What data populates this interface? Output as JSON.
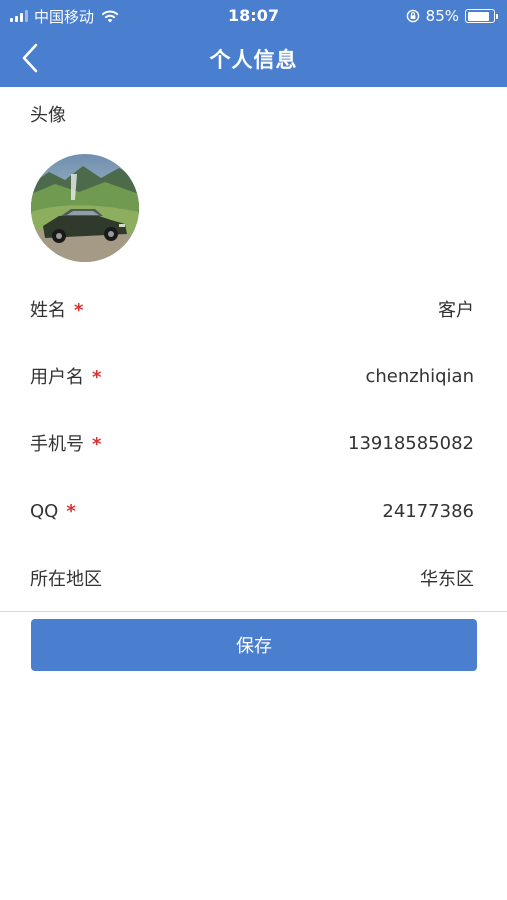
{
  "status_bar": {
    "carrier": "中国移动",
    "time": "18:07",
    "battery_percent": "85%",
    "battery_level": 0.85,
    "icons": [
      "signal-icon",
      "wifi-icon",
      "rotation-lock-icon",
      "battery-icon"
    ]
  },
  "nav": {
    "title": "个人信息",
    "back_icon": "chevron-left-icon"
  },
  "avatar": {
    "label": "头像"
  },
  "form": {
    "rows": [
      {
        "label": "姓名",
        "required": true,
        "value": "客户"
      },
      {
        "label": "用户名",
        "required": true,
        "value": "chenzhiqian"
      },
      {
        "label": "手机号",
        "required": true,
        "value": "13918585082"
      },
      {
        "label": "QQ",
        "required": true,
        "value": "24177386"
      },
      {
        "label": "所在地区",
        "required": false,
        "value": "华东区"
      }
    ],
    "required_mark": "*"
  },
  "actions": {
    "save_label": "保存"
  },
  "colors": {
    "primary": "#4a7fd0",
    "required": "#d93030",
    "text": "#333333",
    "divider": "#d8d8d8"
  }
}
